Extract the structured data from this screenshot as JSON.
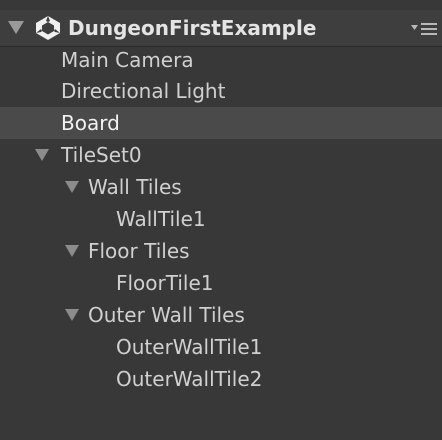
{
  "hierarchy": {
    "scene": {
      "title": "DungeonFirstExample",
      "icon": "unity-logo-icon",
      "menu_icon": "context-menu-icon"
    },
    "items": [
      {
        "label": "Main Camera",
        "depth": 1,
        "expanded": null,
        "selected": false
      },
      {
        "label": "Directional Light",
        "depth": 1,
        "expanded": null,
        "selected": false
      },
      {
        "label": "Board",
        "depth": 1,
        "expanded": null,
        "selected": true
      },
      {
        "label": "TileSet0",
        "depth": 1,
        "expanded": true,
        "selected": false
      },
      {
        "label": "Wall Tiles",
        "depth": 2,
        "expanded": true,
        "selected": false
      },
      {
        "label": "WallTile1",
        "depth": 3,
        "expanded": null,
        "selected": false
      },
      {
        "label": "Floor Tiles",
        "depth": 2,
        "expanded": true,
        "selected": false
      },
      {
        "label": "FloorTile1",
        "depth": 3,
        "expanded": null,
        "selected": false
      },
      {
        "label": "Outer Wall Tiles",
        "depth": 2,
        "expanded": true,
        "selected": false
      },
      {
        "label": "OuterWallTile1",
        "depth": 3,
        "expanded": null,
        "selected": false
      },
      {
        "label": "OuterWallTile2",
        "depth": 3,
        "expanded": null,
        "selected": false
      }
    ],
    "colors": {
      "background": "#383838",
      "selected_row": "#4a4a4a",
      "text": "#d0d0d0"
    }
  }
}
